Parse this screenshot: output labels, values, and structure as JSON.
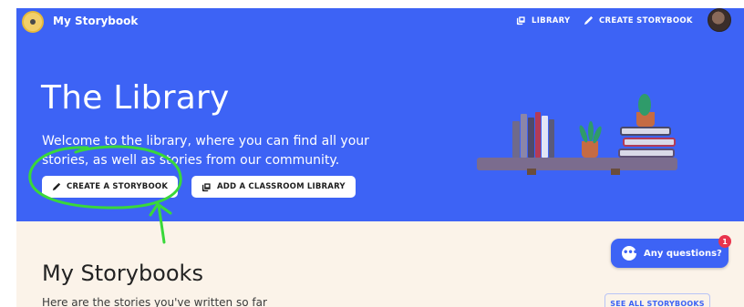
{
  "header": {
    "brand": "My Storybook",
    "nav_library": "LIBRARY",
    "nav_create": "CREATE STORYBOOK"
  },
  "hero": {
    "title": "The Library",
    "subtitle": "Welcome to the library, where you can find all your stories, as well as stories from our community.",
    "create_button": "CREATE A STORYBOOK",
    "classroom_button": "ADD A CLASSROOM LIBRARY"
  },
  "lower": {
    "title": "My Storybooks",
    "subtitle": "Here are the stories you've written so far",
    "see_all": "SEE ALL STORYBOOKS"
  },
  "chat": {
    "label": "Any questions?",
    "badge": "1"
  },
  "colors": {
    "primary": "#3d63f5",
    "lower_bg": "#fbf3e9",
    "annotation": "#39d83a",
    "badge": "#e9344c"
  },
  "icons": {
    "logo": "storybook-logo-icon",
    "library": "library-icon",
    "create": "pencil-icon",
    "classroom": "library-icon",
    "chat": "chat-bubble-icon"
  }
}
